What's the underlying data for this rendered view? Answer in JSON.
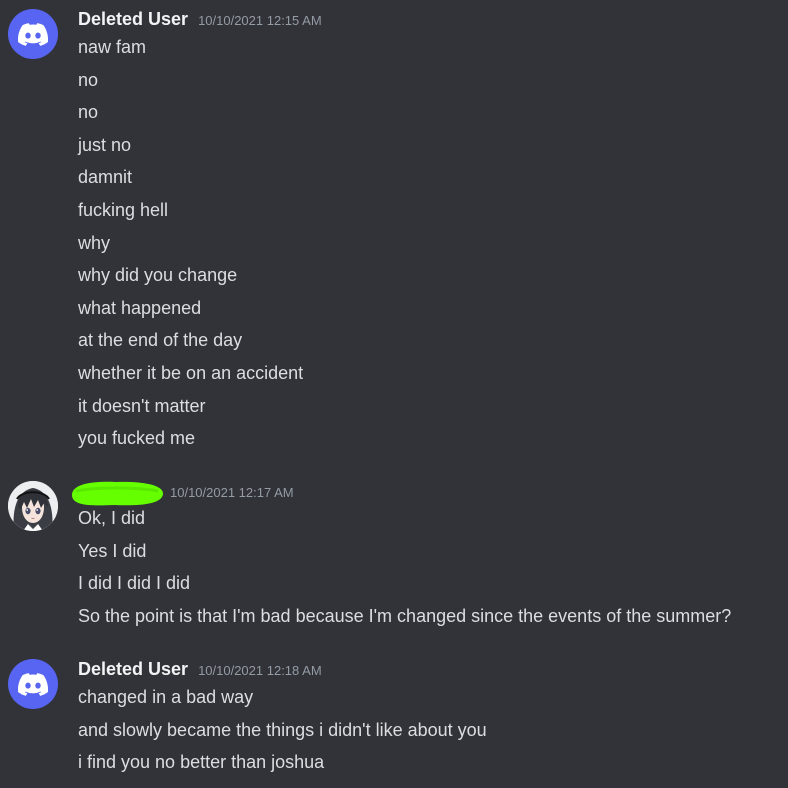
{
  "groups": [
    {
      "username": "Deleted User",
      "timestamp": "10/10/2021 12:15 AM",
      "avatar": "discord-logo-icon",
      "messages": [
        "naw fam",
        "no",
        "no",
        "just no",
        "damnit",
        "fucking hell",
        "why",
        "why did you change",
        "what happened",
        "at the end of the day",
        "whether it be on an accident",
        "it doesn't matter",
        "you fucked me"
      ]
    },
    {
      "username": "",
      "timestamp": "10/10/2021 12:17 AM",
      "avatar": "anime-character-avatar",
      "name_redaction_color": "#66ff00",
      "messages": [
        "Ok, I did",
        "Yes I did",
        "I did I did I did",
        "So the point is that I'm bad because I'm changed since the events of the summer?"
      ]
    },
    {
      "username": "Deleted User",
      "timestamp": "10/10/2021 12:18 AM",
      "avatar": "discord-logo-icon",
      "messages": [
        "changed in a bad way",
        "and slowly became the things i didn't like about you",
        "i find you no better than joshua"
      ]
    }
  ],
  "colors": {
    "background": "#313338",
    "username": "#f2f3f5",
    "message_text": "#dbdee1",
    "timestamp": "#949ba4",
    "discord_blurple": "#5865f2"
  }
}
